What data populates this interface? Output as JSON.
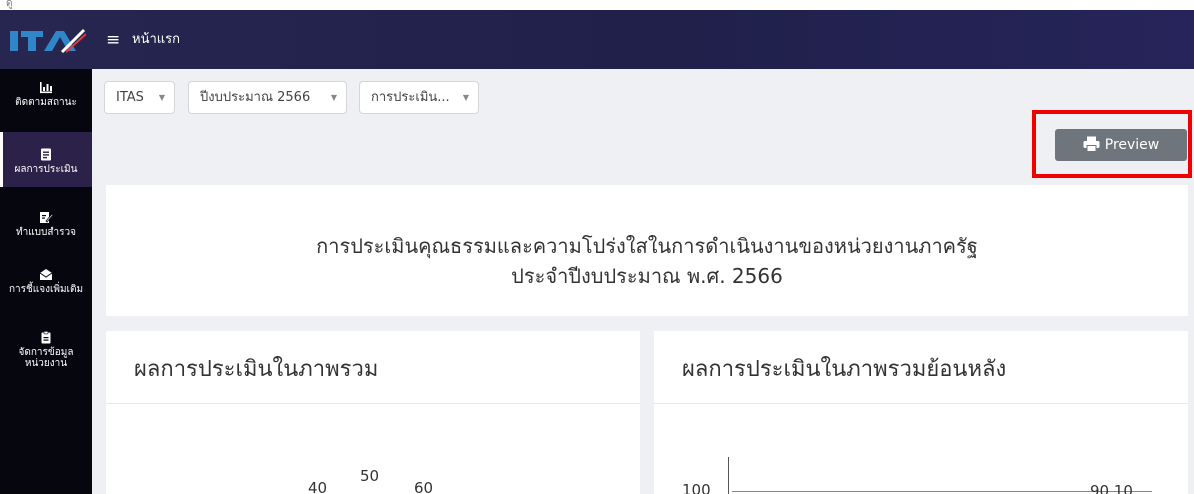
{
  "header": {
    "logo_text": "ITA",
    "menu_icon": "hamburger-icon",
    "page_title": "หน้าแรก"
  },
  "sidebar": {
    "items": [
      {
        "label": "ติดตามสถานะ",
        "icon": "chart-icon",
        "active": false
      },
      {
        "label": "ผลการประเมิน",
        "icon": "report-icon",
        "active": true
      },
      {
        "label": "ทำแบบสำรวจ",
        "icon": "edit-survey-icon",
        "active": false
      },
      {
        "label": "การชี้แจงเพิ่มเติม",
        "icon": "message-icon",
        "active": false
      },
      {
        "label": "จัดการข้อมูล",
        "label2": "หน่วยงาน",
        "icon": "clipboard-icon",
        "active": false
      }
    ]
  },
  "filters": {
    "system": "ITAS",
    "year": "ปีงบประมาณ 2566",
    "assessment": "การประเมิน..."
  },
  "toolbar": {
    "preview_label": "Preview",
    "preview_icon": "print-icon"
  },
  "title_card": {
    "line1": "การประเมินคุณธรรมและความโปร่งใสในการดำเนินงานของหน่วยงานภาครัฐ",
    "line2": "ประจำปีงบประมาณ พ.ศ. 2566"
  },
  "overall": {
    "title": "ผลการประเมินในภาพรวม",
    "gauge_labels": [
      "40",
      "50",
      "60"
    ]
  },
  "history": {
    "title": "ผลการประเมินในภาพรวมย้อนหลัง",
    "y_tick": "100",
    "value_label": "90.10"
  },
  "colors": {
    "header_bg": "#262650",
    "sidebar_bg": "#06060f",
    "highlight": "#f10000",
    "preview_button": "#6f757c"
  }
}
